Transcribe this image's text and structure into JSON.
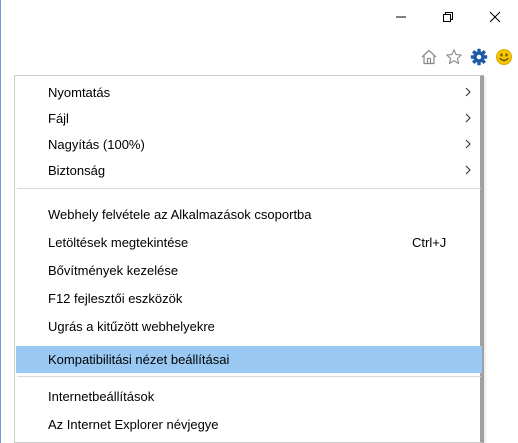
{
  "colors": {
    "highlight": "#99c9f2",
    "gear_icon": "#1c5aa5",
    "smiley_icon": "#f5c400",
    "window_border": "#6a9fd8"
  },
  "window_controls": [
    "minimize-icon",
    "restore-icon",
    "close-icon"
  ],
  "toolbar_icons": [
    "home-icon",
    "favorites-star-icon",
    "gear-icon",
    "smiley-feedback-icon"
  ],
  "menu": {
    "items": [
      {
        "label": "Nyomtatás",
        "submenu": true
      },
      {
        "label": "Fájl",
        "submenu": true
      },
      {
        "label": "Nagyítás (100%)",
        "submenu": true
      },
      {
        "label": "Biztonság",
        "submenu": true
      },
      {
        "label": "Webhely felvétele az Alkalmazások csoportba"
      },
      {
        "label": "Letöltések megtekintése",
        "shortcut": "Ctrl+J"
      },
      {
        "label": "Bővítmények kezelése"
      },
      {
        "label": "F12 fejlesztői eszközök"
      },
      {
        "label": "Ugrás a kitűzött webhelyekre"
      },
      {
        "label": "Kompatibilitási nézet beállításai",
        "highlighted": true
      },
      {
        "label": "Internetbeállítások"
      },
      {
        "label": "Az Internet Explorer névjegye"
      }
    ]
  }
}
